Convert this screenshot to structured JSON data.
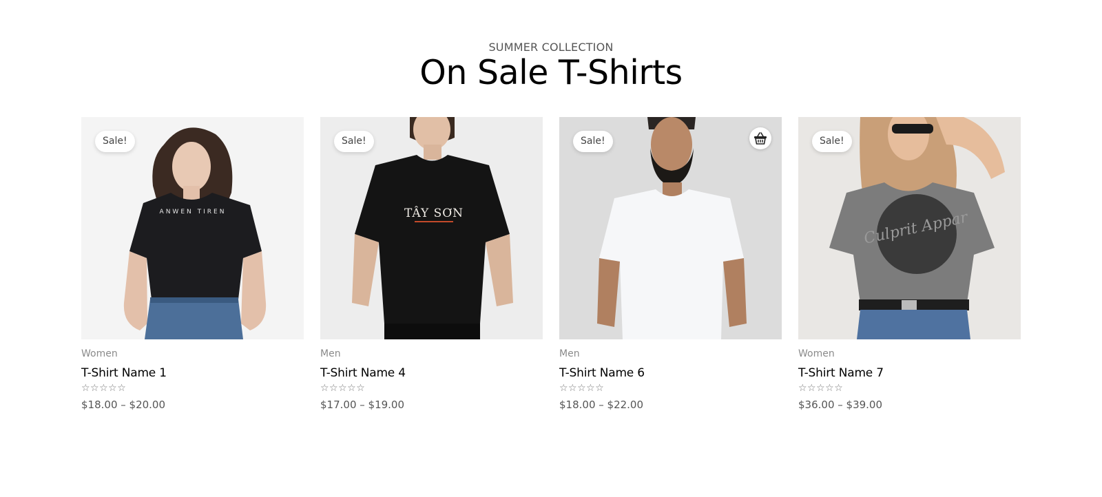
{
  "header": {
    "eyebrow": "SUMMER COLLECTION",
    "title": "On Sale T-Shirts"
  },
  "colors": {
    "badge_bg": "#ffffff",
    "category_text": "#8a8a8a",
    "price_text": "#555555"
  },
  "products": [
    {
      "badge": "Sale!",
      "category": "Women",
      "name": "T-Shirt Name 1",
      "rating_stars": "☆☆☆☆☆",
      "rating_value": 0,
      "price": "$18.00 – $20.00",
      "image_icon": "woman-black-tshirt-photo",
      "shirt_print": "ANWEN TIREN"
    },
    {
      "badge": "Sale!",
      "category": "Men",
      "name": "T-Shirt Name 4",
      "rating_stars": "☆☆☆☆☆",
      "rating_value": 0,
      "price": "$17.00 – $19.00",
      "image_icon": "man-black-tshirt-photo",
      "shirt_print": "TÂY SƠN"
    },
    {
      "badge": "Sale!",
      "category": "Men",
      "name": "T-Shirt Name 6",
      "rating_stars": "☆☆☆☆☆",
      "rating_value": 0,
      "price": "$18.00 – $22.00",
      "image_icon": "man-white-tshirt-photo",
      "quick_add_icon": "basket-icon"
    },
    {
      "badge": "Sale!",
      "category": "Women",
      "name": "T-Shirt Name 7",
      "rating_stars": "☆☆☆☆☆",
      "rating_value": 0,
      "price": "$36.00 – $39.00",
      "image_icon": "woman-grey-tshirt-photo",
      "shirt_print": "Culprit Appar"
    }
  ]
}
